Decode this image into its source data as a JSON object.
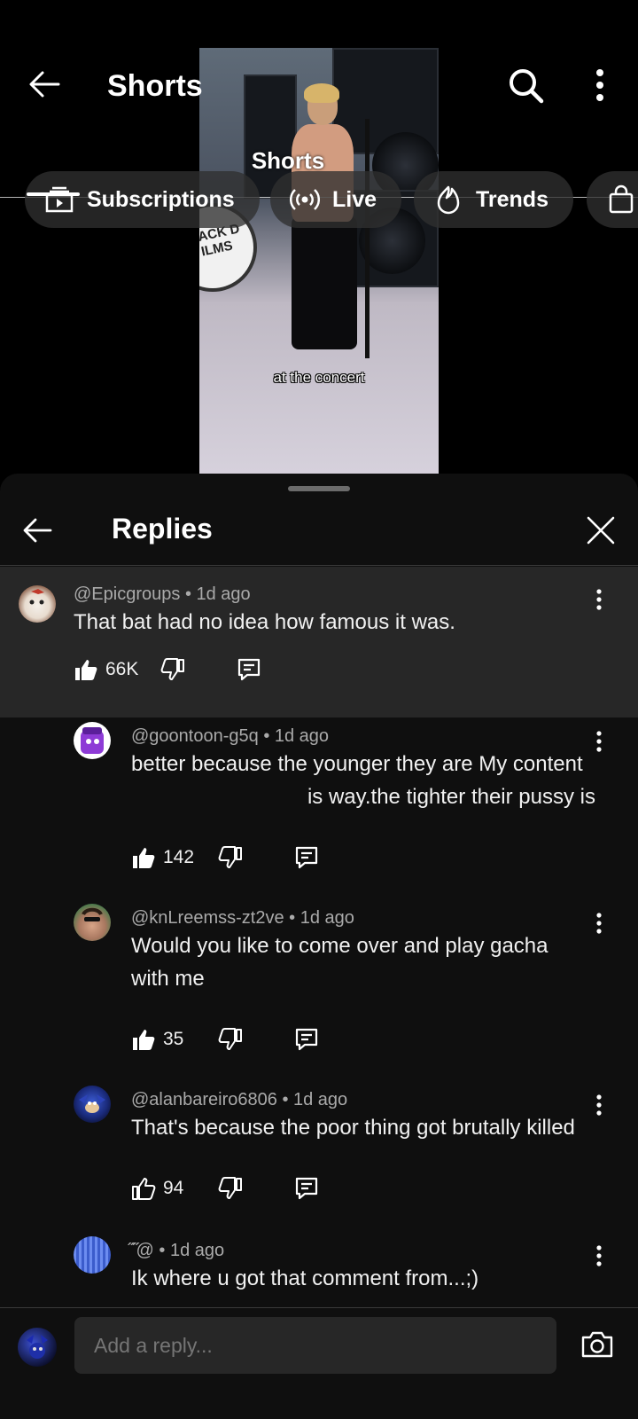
{
  "header": {
    "title": "Shorts"
  },
  "chips": [
    {
      "label": "Subscriptions",
      "icon": "subscriptions-icon"
    },
    {
      "label": "Live",
      "icon": "live-icon"
    },
    {
      "label": "Trends",
      "icon": "trends-icon"
    },
    {
      "label": "",
      "icon": "shopping-bag-icon"
    }
  ],
  "video": {
    "overlay_title": "Shorts",
    "caption": "at the concert",
    "drum_text": "ACK D\nILMS"
  },
  "panel": {
    "title": "Replies"
  },
  "parent_comment": {
    "author": "@Epicgroups",
    "time": "1d ago",
    "text": "That bat had no idea how famous it was.",
    "likes": "66K"
  },
  "replies": [
    {
      "author": "@goontoon-g5q",
      "time": "1d ago",
      "line1": "better because the younger they are My content",
      "line2": "is way.the tighter their pussy is",
      "likes": "142",
      "liked": true
    },
    {
      "author": "@knLreemss-zt2ve",
      "time": "1d ago",
      "line1": "Would you like to come over and play gacha",
      "line2": "with me",
      "likes": "35",
      "liked": true
    },
    {
      "author": "@alanbareiro6806",
      "time": "1d ago",
      "line1": "That's because the poor thing got brutally killed",
      "line2": "",
      "likes": "94",
      "liked": false
    },
    {
      "author": "̋̋  ̋̋@",
      "time": "1d ago",
      "line1": "Ik where u got that comment from...;)",
      "line2": "",
      "likes": "",
      "liked": false
    }
  ],
  "composer": {
    "placeholder": "Add a reply..."
  },
  "colors": {
    "panel_bg": "#0f0f0f",
    "parent_bg": "#272727",
    "meta_text": "#aaaaaa"
  }
}
